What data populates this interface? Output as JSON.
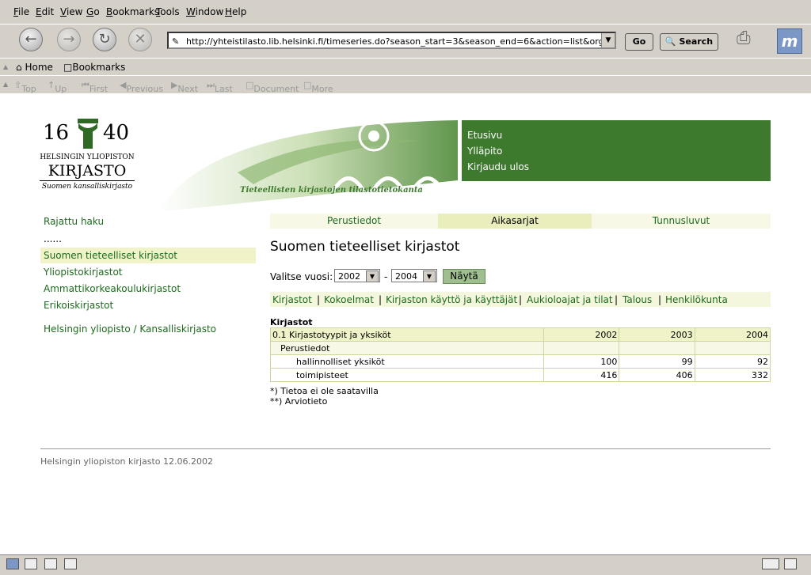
{
  "browser": {
    "menu": [
      "File",
      "Edit",
      "View",
      "Go",
      "Bookmarks",
      "Tools",
      "Window",
      "Help"
    ],
    "url": "http://yhteistilasto.lib.helsinki.fi/timeseries.do?season_start=3&season_end=6&action=list&organization_id=",
    "go_label": "Go",
    "search_label": "Search",
    "personal": {
      "home": "Home",
      "bookmarks": "Bookmarks"
    },
    "sitenav": [
      "Top",
      "Up",
      "First",
      "Previous",
      "Next",
      "Last",
      "Document",
      "More"
    ]
  },
  "header": {
    "logo": {
      "year_left": "16",
      "year_right": "40",
      "line1": "HELSINGIN YLIOPISTON",
      "line2": "KIRJASTO",
      "line3": "Suomen kansalliskirjasto"
    },
    "tagline": "Tieteellisten kirjastojen tilastotietokanta",
    "links": [
      "Etusivu",
      "Ylläpito",
      "Kirjaudu ulos"
    ]
  },
  "sidebar": {
    "items": [
      "Rajattu haku",
      "......",
      "Suomen tieteelliset kirjastot",
      "Yliopistokirjastot",
      "Ammattikorkeakoulukirjastot",
      "Erikoiskirjastot",
      "Helsingin yliopisto / Kansalliskirjasto"
    ]
  },
  "tabs": [
    "Perustiedot",
    "Aikasarjat",
    "Tunnusluvut"
  ],
  "main": {
    "title": "Suomen tieteelliset kirjastot",
    "year_label": "Valitse vuosi:",
    "year_start": "2002",
    "year_sep": "-",
    "year_end": "2004",
    "show_button": "Näytä",
    "categories": [
      "Kirjastot",
      "|",
      "Kokoelmat",
      "|",
      "Kirjaston käyttö ja käyttäjät",
      "|",
      "Aukioloajat ja tilat",
      "|",
      "Talous",
      "|",
      "Henkilökunta"
    ],
    "table_title": "Kirjastot",
    "table": {
      "header": [
        "0.1 Kirjastotyypit ja yksiköt",
        "2002",
        "2003",
        "2004"
      ],
      "group": "Perustiedot",
      "rows": [
        {
          "label": "hallinnolliset yksiköt",
          "values": [
            "100",
            "99",
            "92"
          ]
        },
        {
          "label": "toimipisteet",
          "values": [
            "416",
            "406",
            "332"
          ]
        }
      ]
    },
    "notes": [
      "*) Tietoa ei ole saatavilla",
      "**) Arviotieto"
    ]
  },
  "footer": "Helsingin yliopiston kirjasto 12.06.2002",
  "colors": {
    "green": "#3d7a2e",
    "link": "#1d6a1d",
    "highlight": "#f0f3c8"
  }
}
